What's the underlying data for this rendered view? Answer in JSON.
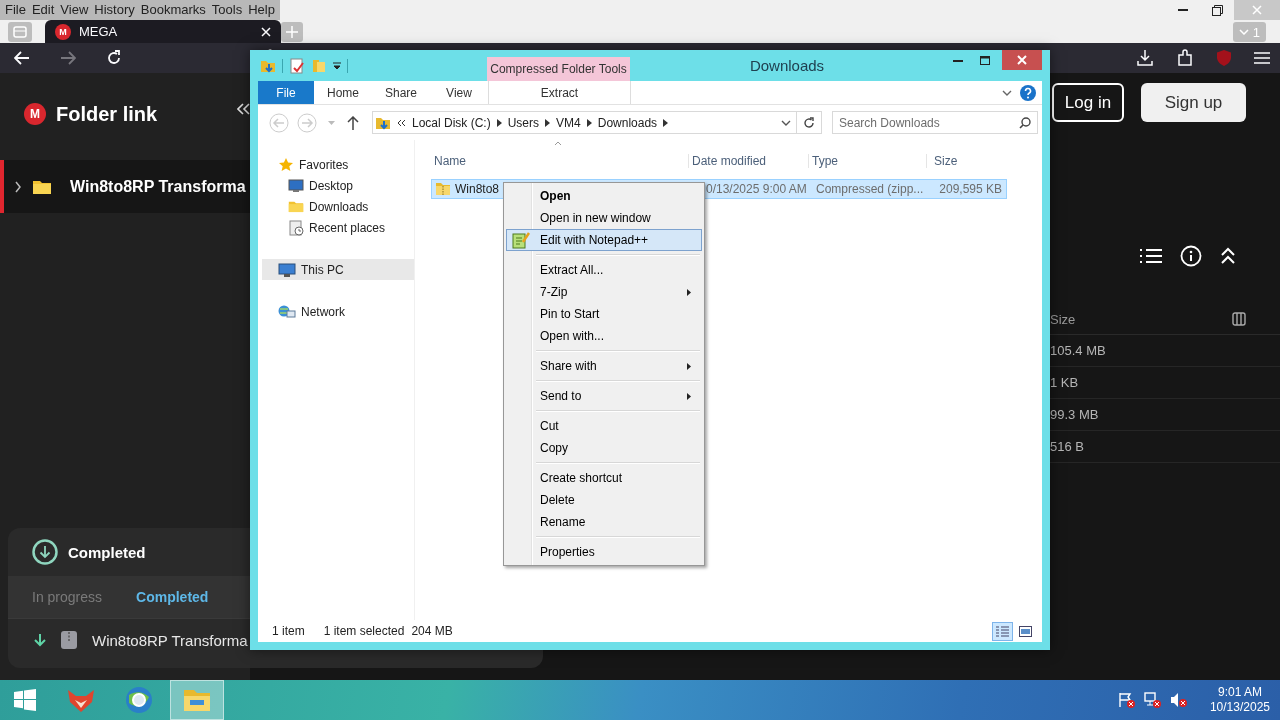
{
  "browser": {
    "menu_bar": [
      "File",
      "Edit",
      "View",
      "History",
      "Bookmarks",
      "Tools",
      "Help"
    ],
    "tabs": [
      {
        "title": "MEGA",
        "favicon_letter": "M",
        "selected": true
      }
    ],
    "tab_count": "1",
    "nav": {
      "back_disabled": false,
      "forward_disabled": true
    }
  },
  "mega": {
    "logo_letter": "M",
    "title": "Folder link",
    "tree": [
      {
        "name": "Win8to8RP Transforma",
        "selected": true,
        "expanded": false
      }
    ],
    "login": "Log in",
    "signup": "Sign up",
    "size_header": "Size",
    "sizes": [
      "105.4 MB",
      "1 KB",
      "99.3 MB",
      "516 B"
    ]
  },
  "transfers": {
    "title": "Completed",
    "tabs": [
      {
        "label": "In progress",
        "selected": false
      },
      {
        "label": "Completed",
        "selected": true
      }
    ],
    "items": [
      {
        "name": "Win8to8RP Transforma"
      }
    ]
  },
  "explorer": {
    "title": "Downloads",
    "context_tab": "Compressed Folder Tools",
    "ribbon_tabs": [
      {
        "label": "File",
        "kind": "file"
      },
      {
        "label": "Home",
        "kind": "tab"
      },
      {
        "label": "Share",
        "kind": "tab"
      },
      {
        "label": "View",
        "kind": "tab"
      },
      {
        "label": "Extract",
        "kind": "context"
      }
    ],
    "path": [
      "Local Disk (C:)",
      "Users",
      "VM4",
      "Downloads"
    ],
    "search_placeholder": "Search Downloads",
    "nav": [
      {
        "label": "Favorites",
        "kind": "favorites",
        "selected": false,
        "children": [
          {
            "label": "Desktop",
            "kind": "desktop",
            "selected": false
          },
          {
            "label": "Downloads",
            "kind": "folder",
            "selected": false
          },
          {
            "label": "Recent places",
            "kind": "recent",
            "selected": false
          }
        ]
      },
      {
        "label": "This PC",
        "kind": "pc",
        "selected": true
      },
      {
        "label": "Network",
        "kind": "network",
        "selected": false
      }
    ],
    "columns": [
      "Name",
      "Date modified",
      "Type",
      "Size"
    ],
    "rows": [
      {
        "name": "Win8to8",
        "date": "0/13/2025 9:00 AM",
        "type": "Compressed (zipp...",
        "size": "209,595 KB",
        "selected": true
      }
    ],
    "status": {
      "count": "1 item",
      "selection": "1 item selected",
      "size": "204 MB"
    },
    "views": [
      {
        "kind": "details",
        "selected": true
      },
      {
        "kind": "tiles",
        "selected": false
      }
    ]
  },
  "context_menu": {
    "groups": [
      [
        {
          "label": "Open",
          "default": true,
          "selected": false
        },
        {
          "label": "Open in new window",
          "selected": false
        },
        {
          "label": "Edit with Notepad++",
          "icon": true,
          "selected": true
        }
      ],
      [
        {
          "label": "Extract All...",
          "selected": false
        },
        {
          "label": "7-Zip",
          "submenu": true,
          "selected": false
        },
        {
          "label": "Pin to Start",
          "selected": false
        },
        {
          "label": "Open with...",
          "selected": false
        }
      ],
      [
        {
          "label": "Share with",
          "submenu": true,
          "selected": false
        }
      ],
      [
        {
          "label": "Send to",
          "submenu": true,
          "selected": false
        }
      ],
      [
        {
          "label": "Cut",
          "selected": false
        },
        {
          "label": "Copy",
          "selected": false
        }
      ],
      [
        {
          "label": "Create shortcut",
          "selected": false
        },
        {
          "label": "Delete",
          "selected": false
        },
        {
          "label": "Rename",
          "selected": false
        }
      ],
      [
        {
          "label": "Properties",
          "selected": false
        }
      ]
    ]
  },
  "taskbar": {
    "apps": [
      {
        "kind": "fox",
        "active": false
      },
      {
        "kind": "globe",
        "active": false
      },
      {
        "kind": "explorer",
        "active": true
      }
    ],
    "time": "9:01 AM",
    "date": "10/13/2025"
  }
}
